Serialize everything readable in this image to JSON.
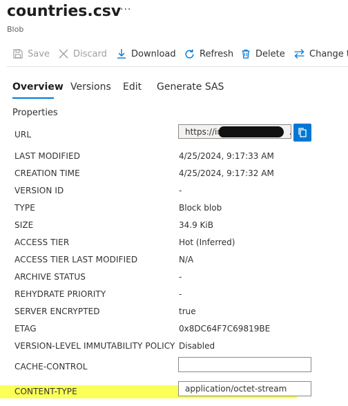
{
  "header": {
    "title": "countries.csv",
    "subtitle": "Blob",
    "more_label": "···"
  },
  "toolbar": {
    "buttons": [
      {
        "label": "Save",
        "icon": "save-icon",
        "enabled": false
      },
      {
        "label": "Discard",
        "icon": "close-icon",
        "enabled": false
      },
      {
        "label": "Download",
        "icon": "download-icon",
        "enabled": true
      },
      {
        "label": "Refresh",
        "icon": "refresh-icon",
        "enabled": true
      },
      {
        "label": "Delete",
        "icon": "trash-icon",
        "enabled": true
      },
      {
        "label": "Change ti",
        "icon": "swap-icon",
        "enabled": true
      }
    ]
  },
  "tabs": [
    {
      "label": "Overview",
      "active": true
    },
    {
      "label": "Versions",
      "active": false
    },
    {
      "label": "Edit",
      "active": false
    },
    {
      "label": "Generate SAS",
      "active": false
    }
  ],
  "properties": {
    "section_title": "Properties",
    "url": {
      "label": "URL",
      "value_prefix": "https://int",
      "value_suffix": "."
    },
    "rows": [
      {
        "label": "LAST MODIFIED",
        "value": "4/25/2024, 9:17:33 AM"
      },
      {
        "label": "CREATION TIME",
        "value": "4/25/2024, 9:17:32 AM"
      },
      {
        "label": "VERSION ID",
        "value": "-"
      },
      {
        "label": "TYPE",
        "value": "Block blob"
      },
      {
        "label": "SIZE",
        "value": "34.9 KiB"
      },
      {
        "label": "ACCESS TIER",
        "value": "Hot (Inferred)"
      },
      {
        "label": "ACCESS TIER LAST MODIFIED",
        "value": "N/A"
      },
      {
        "label": "ARCHIVE STATUS",
        "value": "-"
      },
      {
        "label": "REHYDRATE PRIORITY",
        "value": "-"
      },
      {
        "label": "SERVER ENCRYPTED",
        "value": "true"
      },
      {
        "label": "ETAG",
        "value": "0x8DC64F7C69819BE"
      },
      {
        "label": "VERSION-LEVEL IMMUTABILITY POLICY",
        "value": "Disabled"
      }
    ],
    "cache_control": {
      "label": "CACHE-CONTROL",
      "value": ""
    },
    "content_type": {
      "label": "CONTENT-TYPE",
      "value": "application/octet-stream"
    }
  },
  "colors": {
    "accent": "#0078d4",
    "highlight": "#faff38",
    "disabled_text": "#a19f9d"
  }
}
